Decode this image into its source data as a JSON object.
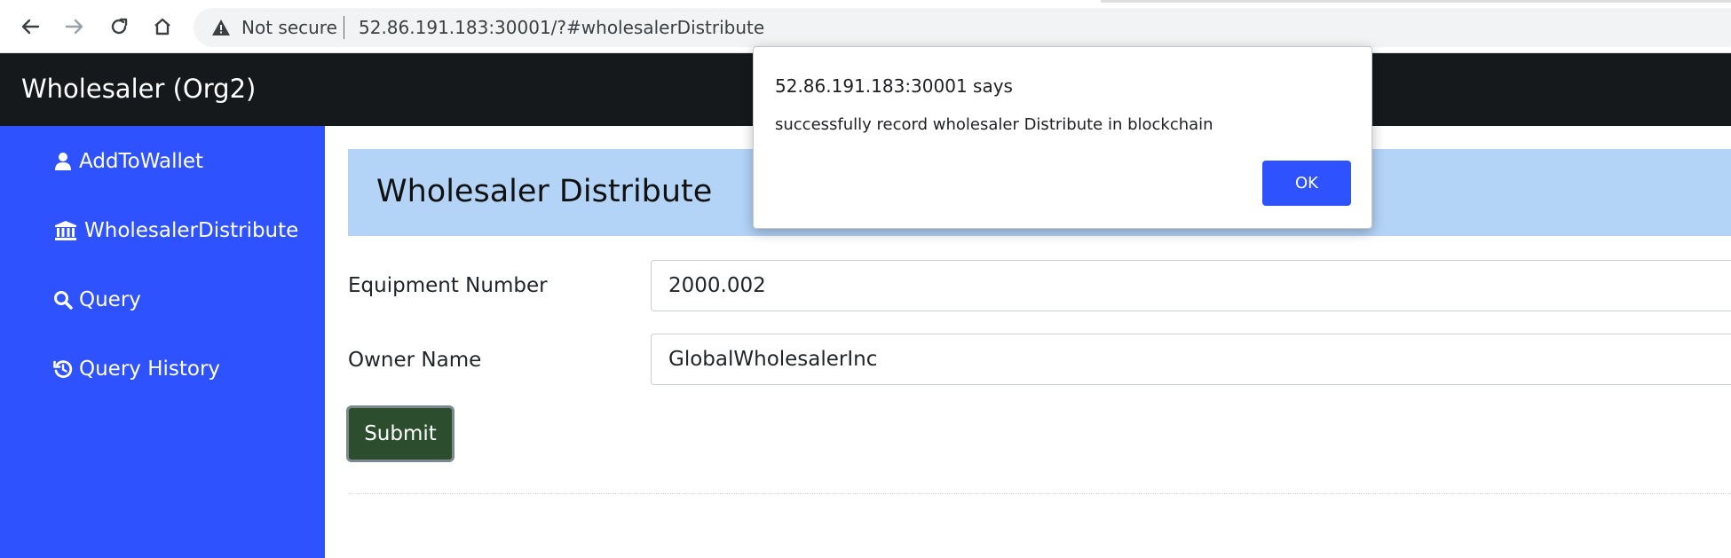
{
  "browser": {
    "security_label": "Not secure",
    "url": "52.86.191.183:30001/?#wholesalerDistribute"
  },
  "navbar": {
    "brand": "Wholesaler (Org2)"
  },
  "sidebar": {
    "items": [
      {
        "label": "AddToWallet",
        "icon": "user-icon"
      },
      {
        "label": "WholesalerDistribute",
        "icon": "bank-icon"
      },
      {
        "label": "Query",
        "icon": "search-icon"
      },
      {
        "label": "Query History",
        "icon": "history-icon"
      }
    ]
  },
  "main": {
    "title": "Wholesaler Distribute",
    "fields": [
      {
        "label": "Equipment Number",
        "value": "2000.002"
      },
      {
        "label": "Owner Name",
        "value": "GlobalWholesalerInc"
      }
    ],
    "submit_label": "Submit"
  },
  "dialog": {
    "title": "52.86.191.183:30001 says",
    "message": "successfully record wholesaler Distribute  in blockchain",
    "ok_label": "OK"
  },
  "colors": {
    "sidebar_bg": "#2f52ff",
    "navbar_bg": "#16191c",
    "header_bg": "#b3d3f7",
    "submit_bg": "#2c4e2e",
    "ok_bg": "#2f52ff"
  }
}
